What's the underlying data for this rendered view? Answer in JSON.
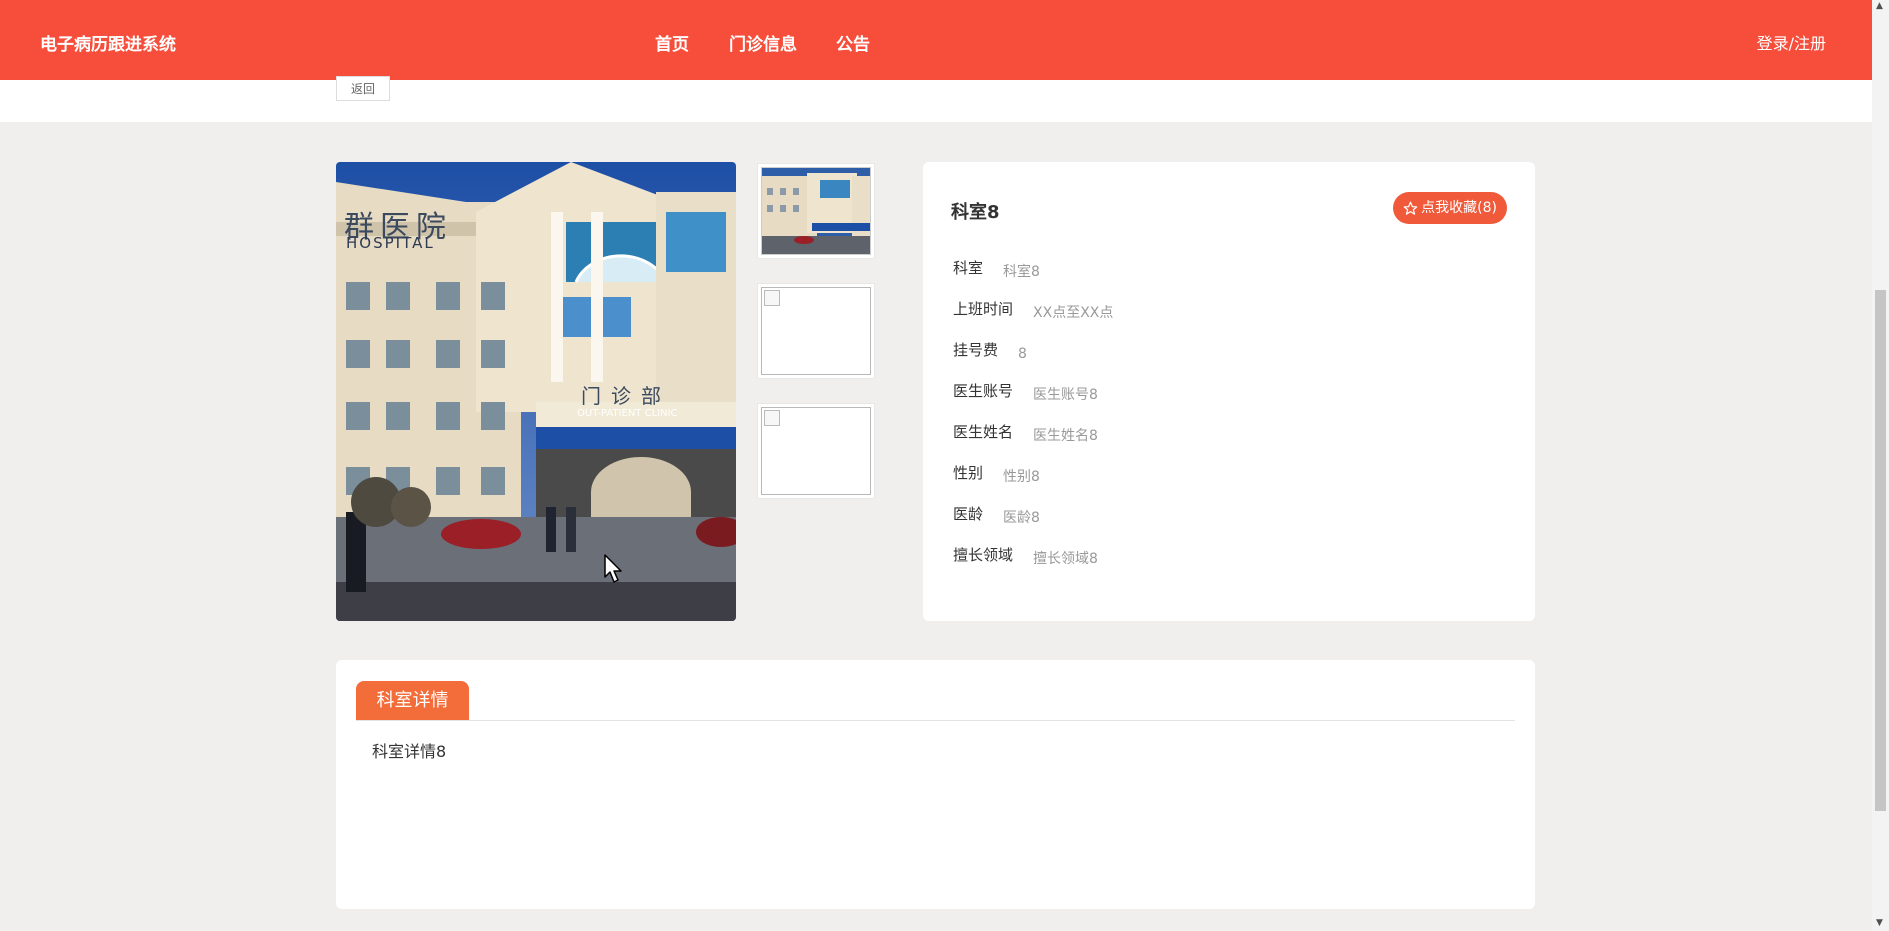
{
  "header": {
    "brand": "电子病历跟进系统",
    "nav": [
      {
        "label": "首页"
      },
      {
        "label": "门诊信息"
      },
      {
        "label": "公告"
      }
    ],
    "login": "登录/注册"
  },
  "toolbar": {
    "back_label": "返回"
  },
  "gallery": {
    "main_image": "hospital-outpatient-building",
    "main_image_signs": [
      "群医院",
      "HOSPITAL",
      "门诊部",
      "OUT-PATIENT CLINIC"
    ]
  },
  "info": {
    "title": "科室8",
    "favorite_label": "点我收藏(8)",
    "favorite_icon": "star-outline-icon",
    "fields": [
      {
        "label": "科室",
        "value": "科室8"
      },
      {
        "label": "上班时间",
        "value": "XX点至XX点"
      },
      {
        "label": "挂号费",
        "value": "8"
      },
      {
        "label": "医生账号",
        "value": "医生账号8"
      },
      {
        "label": "医生姓名",
        "value": "医生姓名8"
      },
      {
        "label": "性别",
        "value": "性别8"
      },
      {
        "label": "医龄",
        "value": "医龄8"
      },
      {
        "label": "擅长领域",
        "value": "擅长领域8"
      }
    ]
  },
  "detail": {
    "tab_label": "科室详情",
    "content": "科室详情8"
  },
  "colors": {
    "header_bg": "#f64e3a",
    "favorite_button": "#f05a3a",
    "tab_bg": "#f36d3a",
    "page_bg": "#f1efee"
  }
}
